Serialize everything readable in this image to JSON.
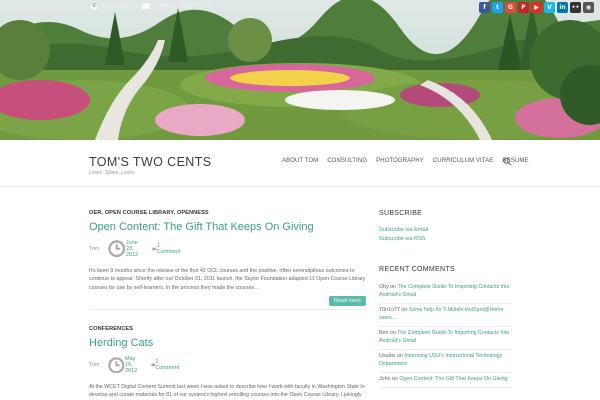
{
  "topbar": {
    "phone": "801-999-0722",
    "email": "cowell.tom@gmail.com",
    "socials": [
      {
        "icon": "facebook-icon",
        "glyph": "f",
        "color": "#3b5998"
      },
      {
        "icon": "twitter-icon",
        "glyph": "t",
        "color": "#1da1f2"
      },
      {
        "icon": "google-plus-icon",
        "glyph": "G",
        "color": "#dd4b39"
      },
      {
        "icon": "pinterest-icon",
        "glyph": "P",
        "color": "#cb2027"
      },
      {
        "icon": "youtube-icon",
        "glyph": "▶",
        "color": "#e52d27"
      },
      {
        "icon": "vimeo-icon",
        "glyph": "V",
        "color": "#1ab7ea"
      },
      {
        "icon": "linkedin-icon",
        "glyph": "in",
        "color": "#0077b5"
      },
      {
        "icon": "flickr-icon",
        "glyph": "••",
        "color": "#333333"
      },
      {
        "icon": "rss-icon",
        "glyph": "◉",
        "color": "#555555"
      }
    ]
  },
  "header": {
    "site_title": "TOM'S TWO CENTS",
    "tagline": "Listen. Share. Learn.",
    "nav": [
      "ABOUT TOM",
      "CONSULTING",
      "PHOTOGRAPHY",
      "CURRICULUM VITAE",
      "RESUME"
    ],
    "search_icon": "search-icon"
  },
  "posts": [
    {
      "categories": "OER, OPEN COURSE LIBRARY, OPENNESS",
      "title": "Open Content: The Gift That Keeps On Giving",
      "author": "Tom",
      "date": "June 23, 2012",
      "comments": "1 Comment",
      "excerpt": "It's been 9 months since the release of the first 42 OCL courses and the positive, often serendipitous outcomes to continue to appear. Shortly after our October 31, 2011 launch, the Saylor Foundation adapted 11 Open Course Library courses for use by self-learners. In the process they made the courses…",
      "read_more": "Read more"
    },
    {
      "categories": "CONFERENCES",
      "title": "Herding Cats",
      "author": "Tom",
      "date": "May 16, 2012",
      "comments": "1 Comment",
      "excerpt": "At the WCET Digital Content Summit last week I was asked to describe how I work with faculty in Washington State to develop and curate materials for 81 of our system's highest enrolling courses into the Open Course Library. I jokingly said two words: \"herding cats,\" and then I went…"
    }
  ],
  "sidebar": {
    "subscribe_title": "SUBSCRIBE",
    "subscribe_links": [
      "Subscribe via Email",
      "Subscribe via RSS"
    ],
    "recent_title": "RECENT COMMENTS",
    "recent_comments": [
      {
        "author": "Oby",
        "on": " on ",
        "post": "The Complete Guide To Importing Contacts Into Android's Gmail"
      },
      {
        "author": "T0n1o77",
        "on": " on ",
        "post": "Some help for T-Mobile HotSpot@Home users…"
      },
      {
        "author": "Ben",
        "on": " on ",
        "post": "The Complete Guide To Importing Contacts Into Android's Gmail"
      },
      {
        "author": "Usudei",
        "on": " on ",
        "post": "Improving USU's Instructional Technology Department"
      },
      {
        "author": "John",
        "on": " on ",
        "post": "Open Content: The Gift That Keeps On Giving"
      }
    ]
  }
}
